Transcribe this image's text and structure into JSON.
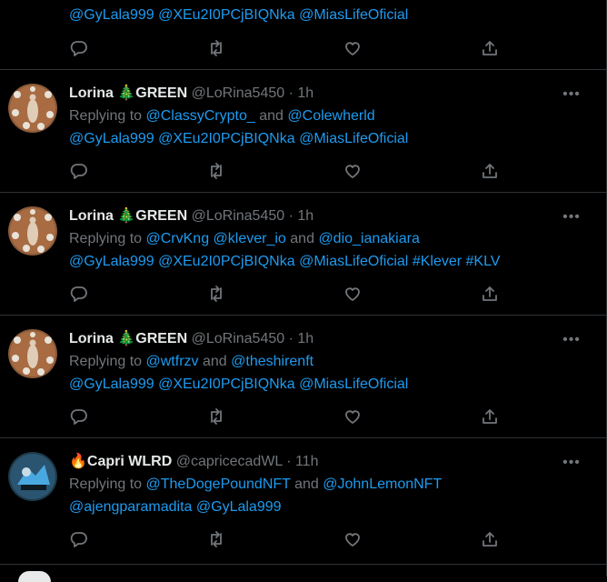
{
  "tweets": [
    {
      "name": "",
      "handle": "",
      "time": "",
      "reply_prefix": "",
      "reply_mentions": [],
      "mentions2": [
        "@GyLala999",
        "@XEu2I0PCjBIQNka",
        "@MiasLifeOficial"
      ],
      "hashtags": []
    },
    {
      "name": "Lorina 🎄GREEN",
      "handle": "@LoRina5450",
      "time": "1h",
      "reply_prefix": "Replying to",
      "reply_mentions": [
        "@ClassyCrypto_",
        "@Colewherld"
      ],
      "mentions2": [
        "@GyLala999",
        "@XEu2I0PCjBIQNka",
        "@MiasLifeOficial"
      ],
      "hashtags": []
    },
    {
      "name": "Lorina 🎄GREEN",
      "handle": "@LoRina5450",
      "time": "1h",
      "reply_prefix": "Replying to",
      "reply_mentions": [
        "@CrvKng",
        "@klever_io",
        "@dio_ianakiara"
      ],
      "mentions2": [
        "@GyLala999",
        "@XEu2I0PCjBIQNka",
        "@MiasLifeOficial"
      ],
      "hashtags": [
        "#Klever",
        "#KLV"
      ]
    },
    {
      "name": "Lorina 🎄GREEN",
      "handle": "@LoRina5450",
      "time": "1h",
      "reply_prefix": "Replying to",
      "reply_mentions": [
        "@wtfrzv",
        "@theshirenft"
      ],
      "mentions2": [
        "@GyLala999",
        "@XEu2I0PCjBIQNka",
        "@MiasLifeOficial"
      ],
      "hashtags": []
    },
    {
      "name": "🔥Capri WLRD",
      "handle": "@capricecadWL",
      "time": "11h",
      "reply_prefix": "Replying to",
      "reply_mentions": [
        "@TheDogePoundNFT",
        "@JohnLemonNFT"
      ],
      "mentions2": [
        "@ajengparamadita",
        "@GyLala999"
      ],
      "hashtags": []
    }
  ],
  "labels": {
    "and": "and",
    "sep": "·",
    "more": "•••"
  },
  "icons": [
    "reply-icon",
    "retweet-icon",
    "like-icon",
    "share-icon",
    "more-icon"
  ],
  "colors": {
    "link": "#1d9bf0",
    "muted": "#71767b",
    "text": "#e7e9ea",
    "border": "#2f3336",
    "background": "#000000"
  }
}
